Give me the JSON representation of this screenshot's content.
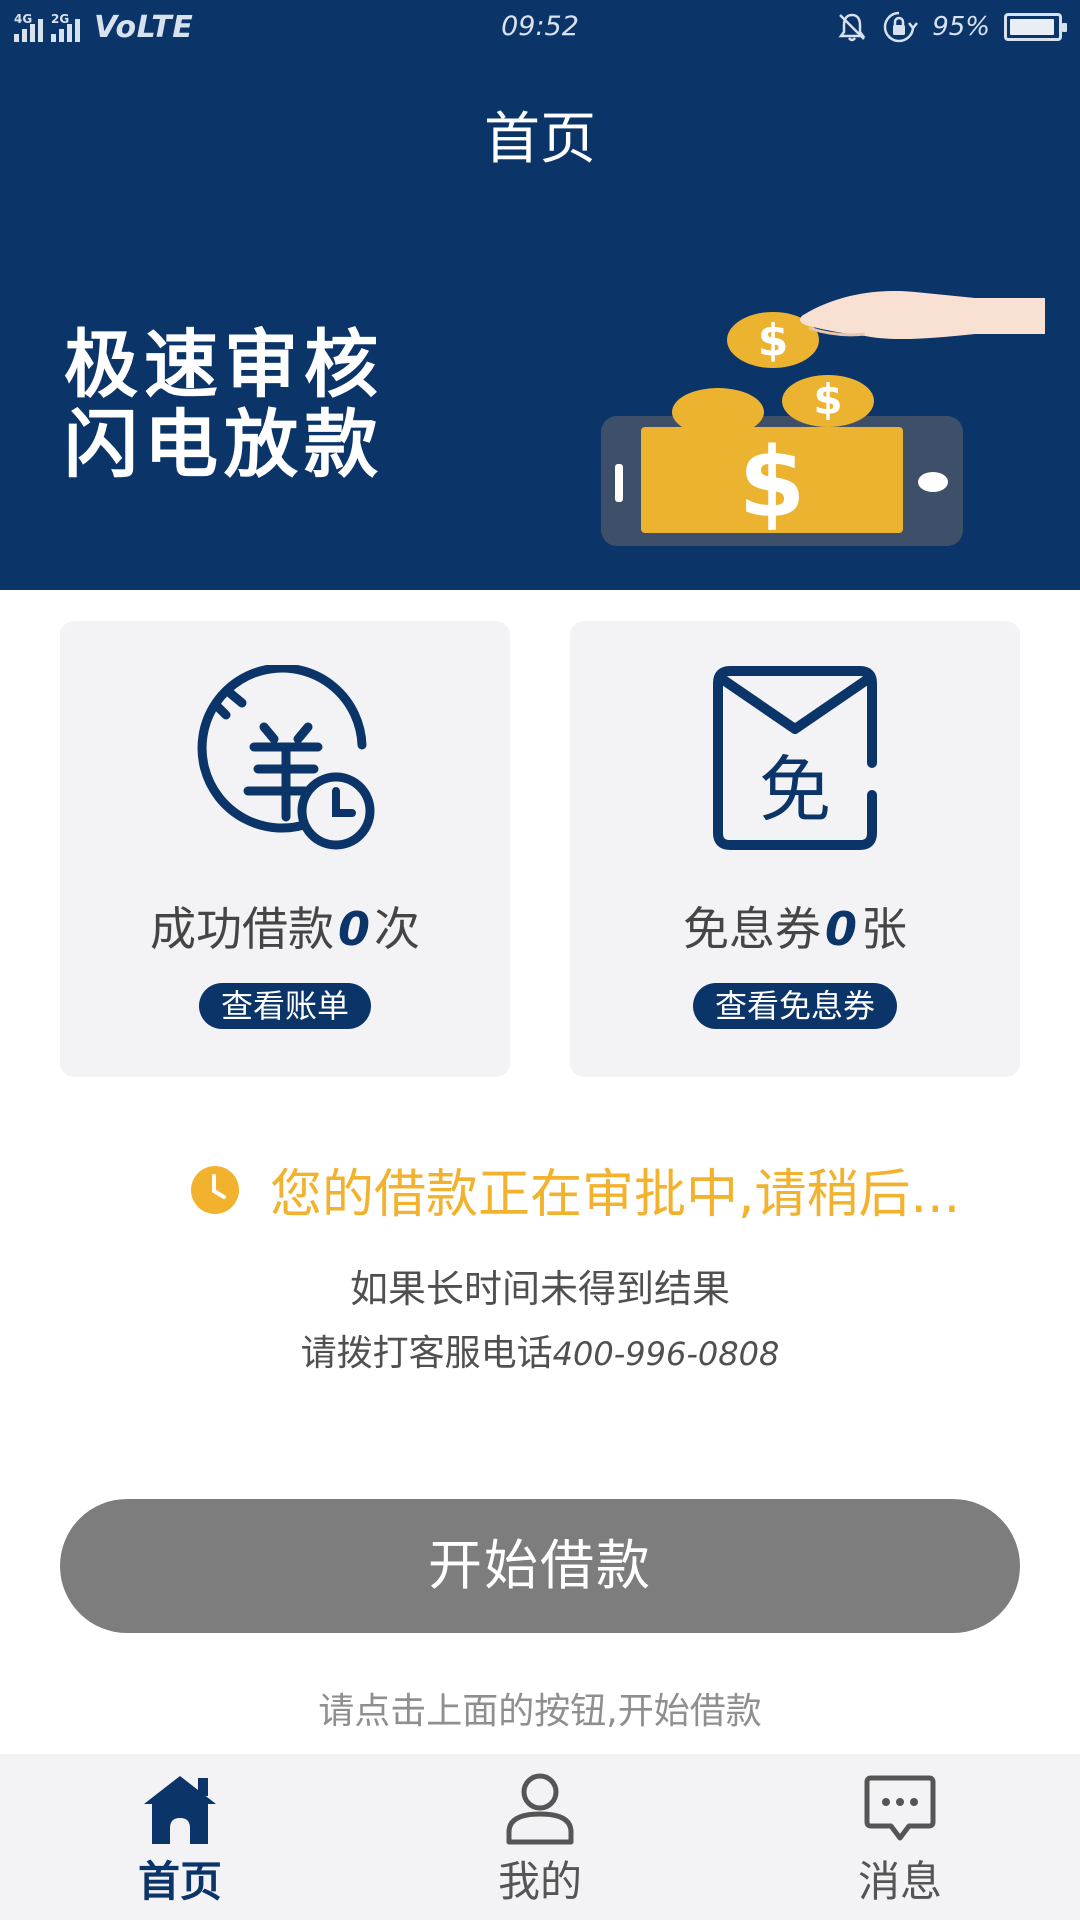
{
  "status_bar": {
    "network_1": "4G",
    "network_2": "2G",
    "volte": "VoLTE",
    "time": "09:52",
    "battery_percent": "95%",
    "battery_level": 0.95,
    "icons": [
      "mute-icon",
      "lock-rotation-icon"
    ]
  },
  "header": {
    "title": "首页"
  },
  "banner": {
    "line1": "极速审核",
    "line2": "闪电放款",
    "colors": {
      "background": "#0b3469",
      "coin": "#ebb32f",
      "phone": "#3e4f6a"
    }
  },
  "cards": {
    "loans": {
      "prefix": "成功借款",
      "count": "0",
      "suffix": "次",
      "button": "查看账单",
      "icon": "yuan-clock-icon"
    },
    "coupons": {
      "prefix": "免息券",
      "count": "0",
      "suffix": "张",
      "button": "查看免息券",
      "icon": "free-coupon-envelope-icon"
    }
  },
  "notice": {
    "text": "您的借款正在审批中,请稍后...",
    "hint_line1": "如果长时间未得到结果",
    "hint_line2_prefix": "请拨打客服电话",
    "phone": "400-996-0808",
    "icon": "clock-icon"
  },
  "actions": {
    "start_loan": "开始借款",
    "start_hint": "请点击上面的按钮,开始借款"
  },
  "nav": {
    "items": [
      {
        "label": "首页",
        "icon": "home-icon",
        "active": true
      },
      {
        "label": "我的",
        "icon": "user-icon",
        "active": false
      },
      {
        "label": "消息",
        "icon": "message-icon",
        "active": false
      }
    ]
  },
  "colors": {
    "brand": "#0b3469",
    "accent": "#f2b22d",
    "button_disabled": "#7d7d7d",
    "card_bg": "#f3f3f5"
  }
}
